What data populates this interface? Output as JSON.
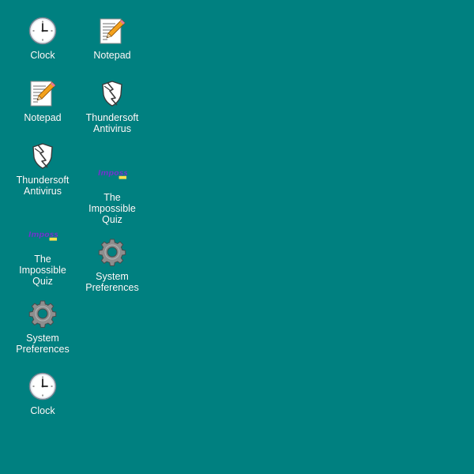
{
  "desktop": {
    "background_color": "#008080",
    "columns": [
      {
        "icons": [
          {
            "icon": "clock-icon",
            "label": "Clock"
          },
          {
            "icon": "notepad-icon",
            "label": "Notepad"
          },
          {
            "icon": "antivirus-shield-icon",
            "label": "Thundersoft\nAntivirus"
          },
          {
            "icon": "impossible-quiz-logo-icon",
            "label": "The\nImpossible\nQuiz"
          },
          {
            "icon": "gear-icon",
            "label": "System\nPreferences"
          },
          {
            "icon": "clock-icon",
            "label": "Clock"
          }
        ]
      },
      {
        "icons": [
          {
            "icon": "notepad-icon",
            "label": "Notepad"
          },
          {
            "icon": "antivirus-shield-icon",
            "label": "Thundersoft\nAntivirus"
          },
          {
            "icon": "impossible-quiz-logo-icon",
            "label": "The\nImpossible\nQuiz"
          },
          {
            "icon": "gear-icon",
            "label": "System\nPreferences"
          }
        ]
      }
    ]
  }
}
